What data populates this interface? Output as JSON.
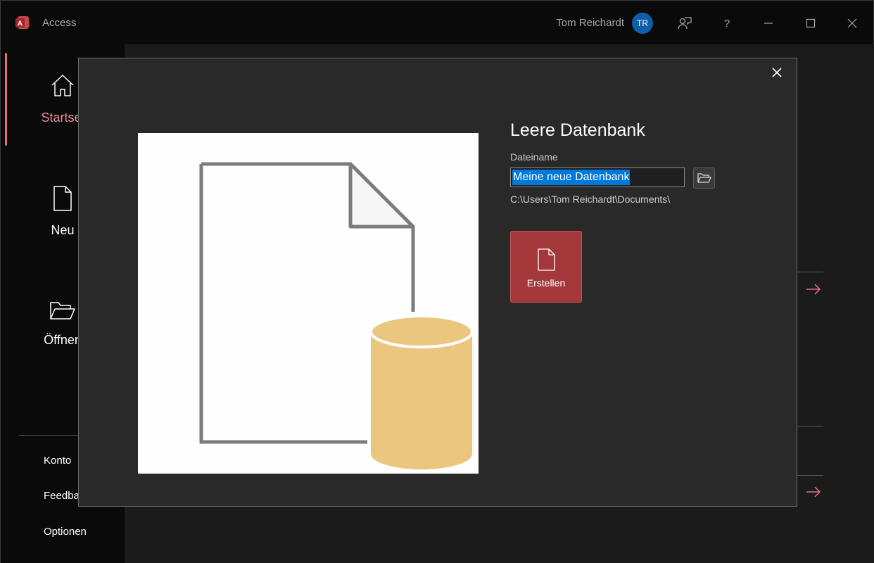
{
  "titlebar": {
    "app_name": "Access",
    "user_name": "Tom Reichardt",
    "user_initials": "TR",
    "feedback_icon": "feedback-icon",
    "help_label": "?",
    "minimize_icon": "minimize-icon",
    "maximize_icon": "maximize-icon",
    "close_icon": "close-icon"
  },
  "sidebar": {
    "items": [
      {
        "label": "Startsei",
        "icon": "home-icon",
        "active": true
      },
      {
        "label": "Neu",
        "icon": "new-document-icon",
        "active": false
      },
      {
        "label": "Öffnen",
        "icon": "open-folder-icon",
        "active": false
      }
    ],
    "links": [
      "Konto",
      "Feedba",
      "Optionen"
    ]
  },
  "dialog": {
    "title": "Leere Datenbank",
    "filename_label": "Dateiname",
    "filename_value": "Meine neue Datenbank",
    "path": "C:\\Users\\Tom Reichardt\\Documents\\",
    "create_label": "Erstellen",
    "close_icon": "close-icon",
    "browse_icon": "folder-open-icon"
  },
  "colors": {
    "accent": "#a4373a",
    "accent_text": "#f08d97",
    "avatar": "#0d5ea8",
    "selection": "#0078d7"
  }
}
